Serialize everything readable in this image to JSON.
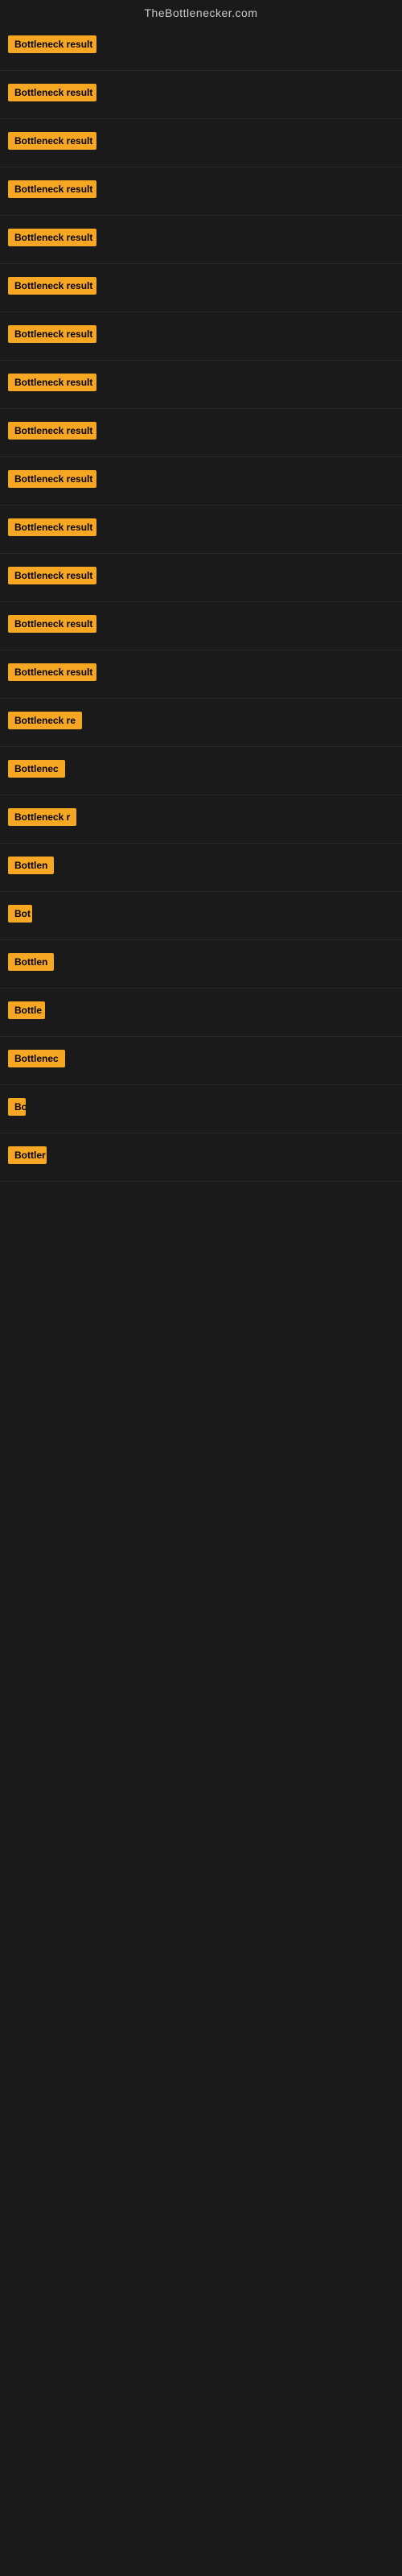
{
  "header": {
    "title": "TheBottlenecker.com"
  },
  "items": [
    {
      "id": 1,
      "label": "Bottleneck result",
      "visible_width": "full"
    },
    {
      "id": 2,
      "label": "Bottleneck result",
      "visible_width": "full"
    },
    {
      "id": 3,
      "label": "Bottleneck result",
      "visible_width": "full"
    },
    {
      "id": 4,
      "label": "Bottleneck result",
      "visible_width": "full"
    },
    {
      "id": 5,
      "label": "Bottleneck result",
      "visible_width": "full"
    },
    {
      "id": 6,
      "label": "Bottleneck result",
      "visible_width": "full"
    },
    {
      "id": 7,
      "label": "Bottleneck result",
      "visible_width": "full"
    },
    {
      "id": 8,
      "label": "Bottleneck result",
      "visible_width": "full"
    },
    {
      "id": 9,
      "label": "Bottleneck result",
      "visible_width": "full"
    },
    {
      "id": 10,
      "label": "Bottleneck result",
      "visible_width": "full"
    },
    {
      "id": 11,
      "label": "Bottleneck result",
      "visible_width": "full"
    },
    {
      "id": 12,
      "label": "Bottleneck result",
      "visible_width": "full"
    },
    {
      "id": 13,
      "label": "Bottleneck result",
      "visible_width": "full"
    },
    {
      "id": 14,
      "label": "Bottleneck result",
      "visible_width": "full"
    },
    {
      "id": 15,
      "label": "Bottleneck re",
      "visible_width": "partial-large"
    },
    {
      "id": 16,
      "label": "Bottlenec",
      "visible_width": "partial-medium"
    },
    {
      "id": 17,
      "label": "Bottleneck r",
      "visible_width": "partial-medium-large"
    },
    {
      "id": 18,
      "label": "Bottlen",
      "visible_width": "partial-small-medium"
    },
    {
      "id": 19,
      "label": "Bot",
      "visible_width": "partial-tiny"
    },
    {
      "id": 20,
      "label": "Bottlen",
      "visible_width": "partial-small-medium"
    },
    {
      "id": 21,
      "label": "Bottle",
      "visible_width": "partial-small"
    },
    {
      "id": 22,
      "label": "Bottlenec",
      "visible_width": "partial-medium"
    },
    {
      "id": 23,
      "label": "Bo",
      "visible_width": "partial-tiny-2"
    },
    {
      "id": 24,
      "label": "Bottler",
      "visible_width": "partial-small-2"
    }
  ],
  "badge_color": "#f5a623"
}
